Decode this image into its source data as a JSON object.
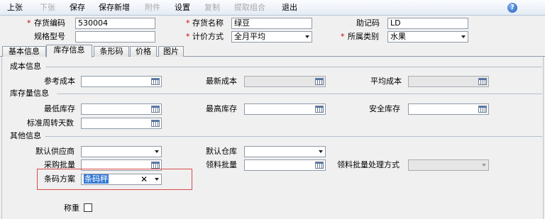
{
  "toolbar": {
    "prev": "上张",
    "next": "下张",
    "save": "保存",
    "save_new": "保存新增",
    "attach": "附件",
    "settings": "设置",
    "copy": "复制",
    "extract_combo": "提取组合",
    "exit": "退出"
  },
  "header": {
    "code_label": "存货编码",
    "code_value": "530004",
    "name_label": "存货名称",
    "name_value": "绿豆",
    "mnemonic_label": "助记码",
    "mnemonic_value": "LD",
    "spec_label": "规格型号",
    "spec_value": "",
    "pricing_label": "计价方式",
    "pricing_value": "全月平均",
    "category_label": "所属类别",
    "category_value": "水果",
    "required_mark": "*"
  },
  "tabs": [
    "基本信息",
    "库存信息",
    "条形码",
    "价格",
    "图片"
  ],
  "cost": {
    "section": "成本信息",
    "ref_cost": "参考成本",
    "latest_cost": "最新成本",
    "avg_cost": "平均成本"
  },
  "inventory": {
    "section": "库存量信息",
    "min_stock": "最低库存",
    "max_stock": "最高库存",
    "safety_stock": "安全库存",
    "turnover_days": "标准周转天数"
  },
  "other": {
    "section": "其他信息",
    "default_supplier": "默认供应商",
    "default_warehouse": "默认仓库",
    "purchase_batch": "采购批量",
    "picking_batch": "领料批量",
    "picking_method": "领料批量处理方式",
    "barcode_scheme": "条码方案",
    "barcode_value": "条码秤",
    "weigh": "称重"
  }
}
